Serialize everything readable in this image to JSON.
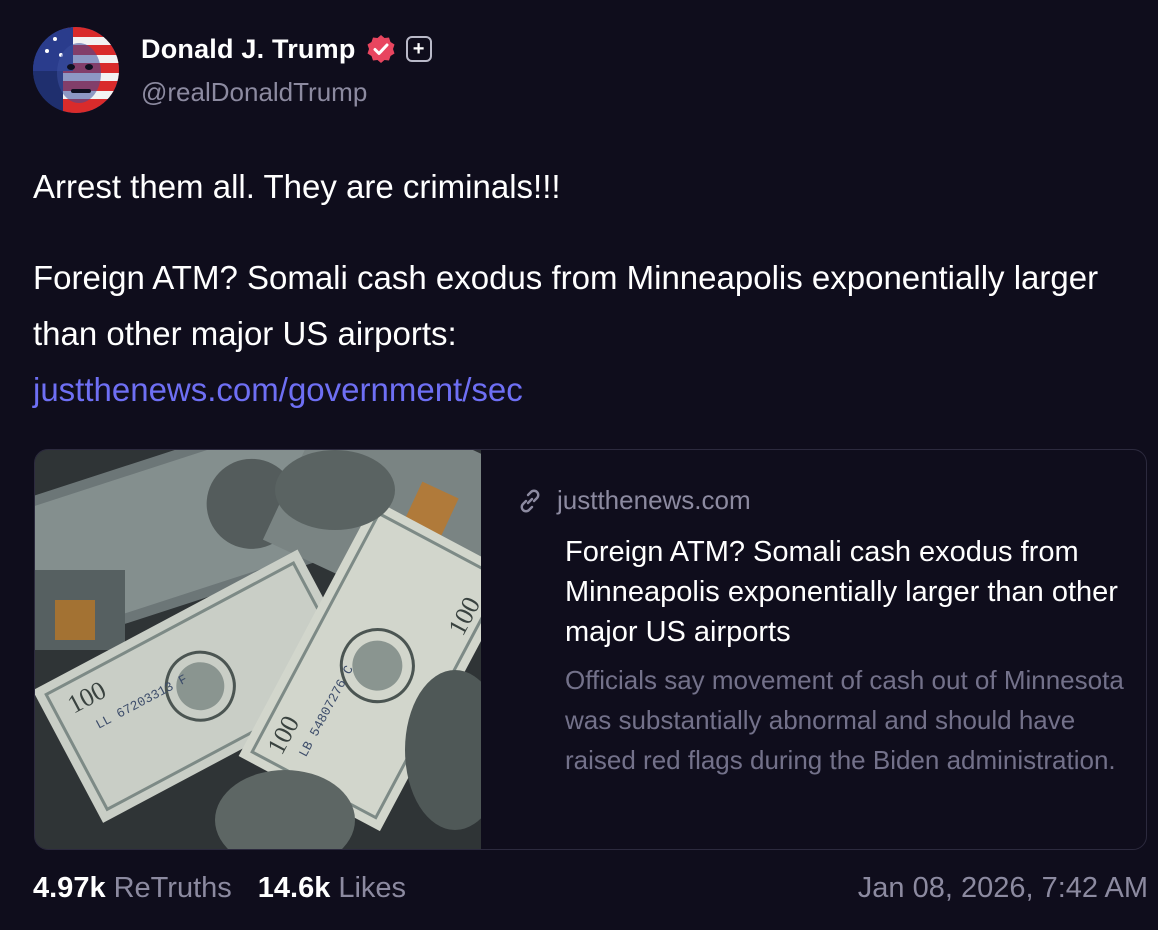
{
  "author": {
    "display_name": "Donald J. Trump",
    "handle": "@realDonaldTrump",
    "plus_badge": "+",
    "verified_icon": "verified-check-icon"
  },
  "post": {
    "line1": "Arrest them all. They are criminals!!!",
    "line2": "Foreign ATM? Somali cash exodus from Minneapolis exponentially larger than other major US airports:",
    "link_text": "justthenews.com/government/sec"
  },
  "link_card": {
    "domain": "justthenews.com",
    "title": "Foreign ATM? Somali cash exodus from Minneapolis exponentially larger than other major US airports",
    "description": "Officials say movement of cash out of Minnesota was substantially abnormal and should have raised red flags during the Biden administration."
  },
  "stats": {
    "retruths_count": "4.97k",
    "retruths_label": "ReTruths",
    "likes_count": "14.6k",
    "likes_label": "Likes"
  },
  "timestamp": "Jan 08, 2026, 7:42 AM",
  "colors": {
    "background": "#0f0d1c",
    "link": "#6e6ff4",
    "verified": "#e8455f",
    "muted": "#8c8aa0"
  }
}
